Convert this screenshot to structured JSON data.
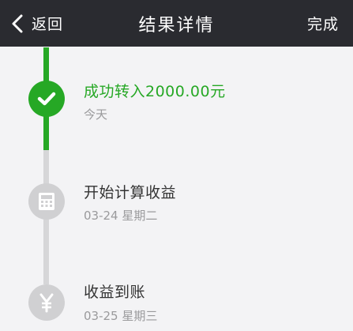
{
  "navbar": {
    "back_label": "返回",
    "title": "结果详情",
    "done_label": "完成"
  },
  "steps": [
    {
      "title": "成功转入2000.00元",
      "subtitle": "今天",
      "status": "done",
      "icon": "check-icon"
    },
    {
      "title": "开始计算收益",
      "subtitle": "03-24 星期二",
      "status": "pending",
      "icon": "calculator-icon"
    },
    {
      "title": "收益到账",
      "subtitle": "03-25 星期三",
      "status": "pending",
      "icon": "yen-icon"
    }
  ],
  "colors": {
    "navbar_bg": "#2a2b30",
    "success": "#26a825",
    "pending": "#d0d0d2",
    "background": "#f3f3f5"
  }
}
